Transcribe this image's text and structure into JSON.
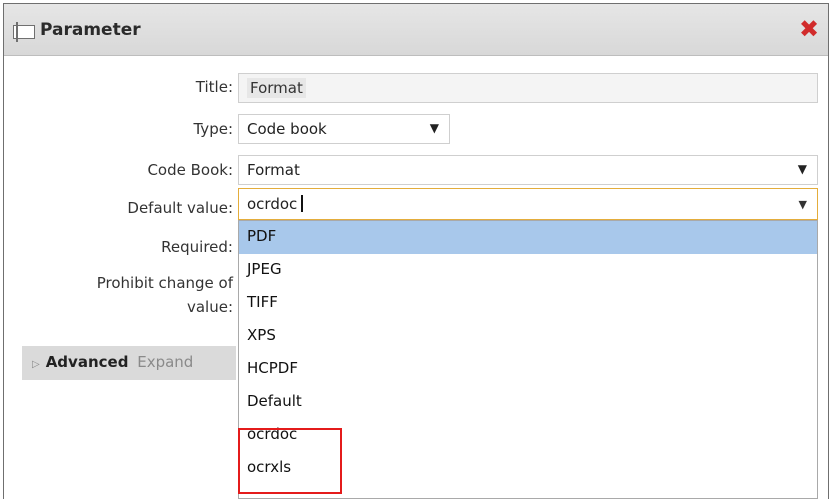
{
  "dialog": {
    "title": "Parameter"
  },
  "form": {
    "title_label": "Title:",
    "title_value": "Format",
    "type_label": "Type:",
    "type_value": "Code book",
    "codebook_label": "Code Book:",
    "codebook_value": "Format",
    "default_label": "Default value:",
    "default_value": "ocrdoc",
    "required_label": "Required:",
    "prohibit_label_line1": "Prohibit change of",
    "prohibit_label_line2": "value:"
  },
  "dropdown": {
    "options": [
      "PDF",
      "JPEG",
      "TIFF",
      "XPS",
      "HCPDF",
      "Default",
      "ocrdoc",
      "ocrxls"
    ],
    "selected_index": 0,
    "highlighted_options": [
      "ocrdoc",
      "ocrxls"
    ]
  },
  "advanced": {
    "label": "Advanced",
    "expand": "Expand"
  },
  "colors": {
    "selection": "#a8c8eb",
    "highlight_border": "#e41b1b",
    "focus_border": "#e4ad3b",
    "close_icon": "#d12b2b"
  }
}
